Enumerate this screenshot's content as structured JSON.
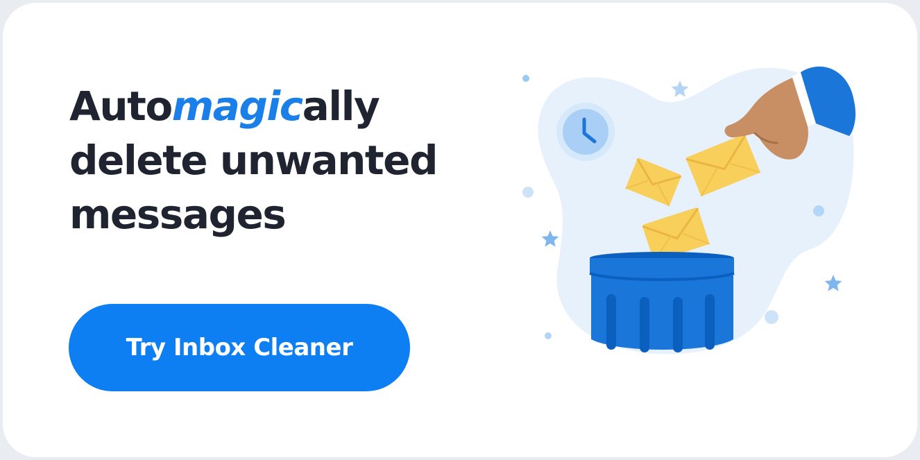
{
  "headline": {
    "line1_part1": "Auto",
    "line1_magic": "magic",
    "line1_part2": "ally",
    "line2": "delete unwanted",
    "line3": "messages"
  },
  "cta": {
    "label": "Try Inbox Cleaner"
  },
  "illustration": {
    "icons": [
      "clock-icon",
      "envelope-icon",
      "trash-can-icon",
      "hand-icon",
      "star-icon"
    ]
  },
  "colors": {
    "accent": "#0d7ff2",
    "text": "#1f2430",
    "envelope": "#f7cf5a",
    "blob": "#e6f1fc"
  }
}
